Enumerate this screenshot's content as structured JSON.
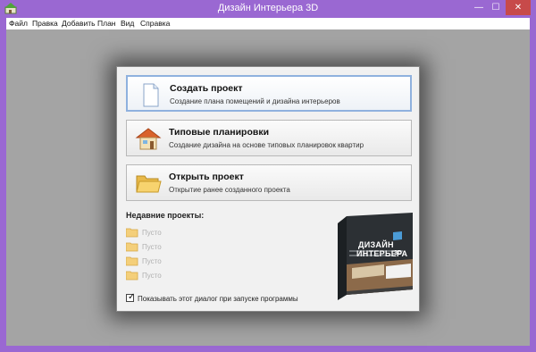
{
  "window": {
    "title": "Дизайн Интерьера 3D",
    "controls": {
      "minimize": "—",
      "maximize": "☐",
      "close": "✕"
    }
  },
  "menu": [
    "Файл",
    "Правка",
    "Добавить",
    "План",
    "Вид",
    "Справка"
  ],
  "actions": [
    {
      "label": "Создать проект",
      "desc": "Создание плана помещений и дизайна интерьеров",
      "icon": "new-document-icon"
    },
    {
      "label": "Типовые планировки",
      "desc": "Создание дизайна на основе типовых планировок квартир",
      "icon": "house-icon"
    },
    {
      "label": "Открыть проект",
      "desc": "Открытие ранее созданного проекта",
      "icon": "open-folder-icon"
    }
  ],
  "recent": {
    "title": "Недавние проекты:",
    "items": [
      "Пусто",
      "Пусто",
      "Пусто",
      "Пусто"
    ]
  },
  "startup_checkbox": {
    "label": "Показывать этот диалог при запуске программы",
    "checked": true
  },
  "box": {
    "title_line1": "ДИЗАЙН",
    "title_line2": "ИНТЕРЬЕРА",
    "badge": "3D"
  },
  "colors": {
    "title_bar": "#9a68d2",
    "close_button": "#c74a4a",
    "selection_border": "#8fb1de"
  }
}
